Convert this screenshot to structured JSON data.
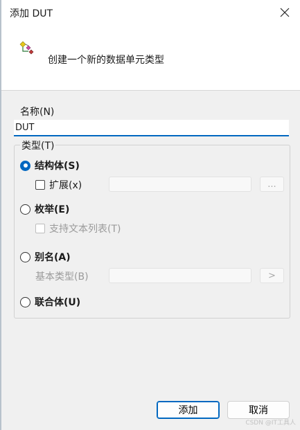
{
  "window": {
    "title": "添加 DUT"
  },
  "header": {
    "description": "创建一个新的数据单元类型"
  },
  "name_field": {
    "label": "名称(N)",
    "value": "DUT"
  },
  "type_group": {
    "legend": "类型(T)",
    "options": [
      {
        "label": "结构体(S)",
        "selected": true
      },
      {
        "label": "枚举(E)",
        "selected": false
      },
      {
        "label": "别名(A)",
        "selected": false
      },
      {
        "label": "联合体(U)",
        "selected": false
      }
    ],
    "extends_checkbox": {
      "label": "扩展(x)",
      "browse_label": "..."
    },
    "text_list_checkbox": {
      "label": "支持文本列表(T)"
    },
    "base_type": {
      "label": "基本类型(B)",
      "browse_label": ">"
    }
  },
  "buttons": {
    "add": "添加",
    "cancel": "取消"
  },
  "watermark": "CSDN @IT工具人",
  "colors": {
    "accent": "#0067c0",
    "dialog_bg": "#f0f0f0",
    "header_bg": "#ffffff"
  }
}
